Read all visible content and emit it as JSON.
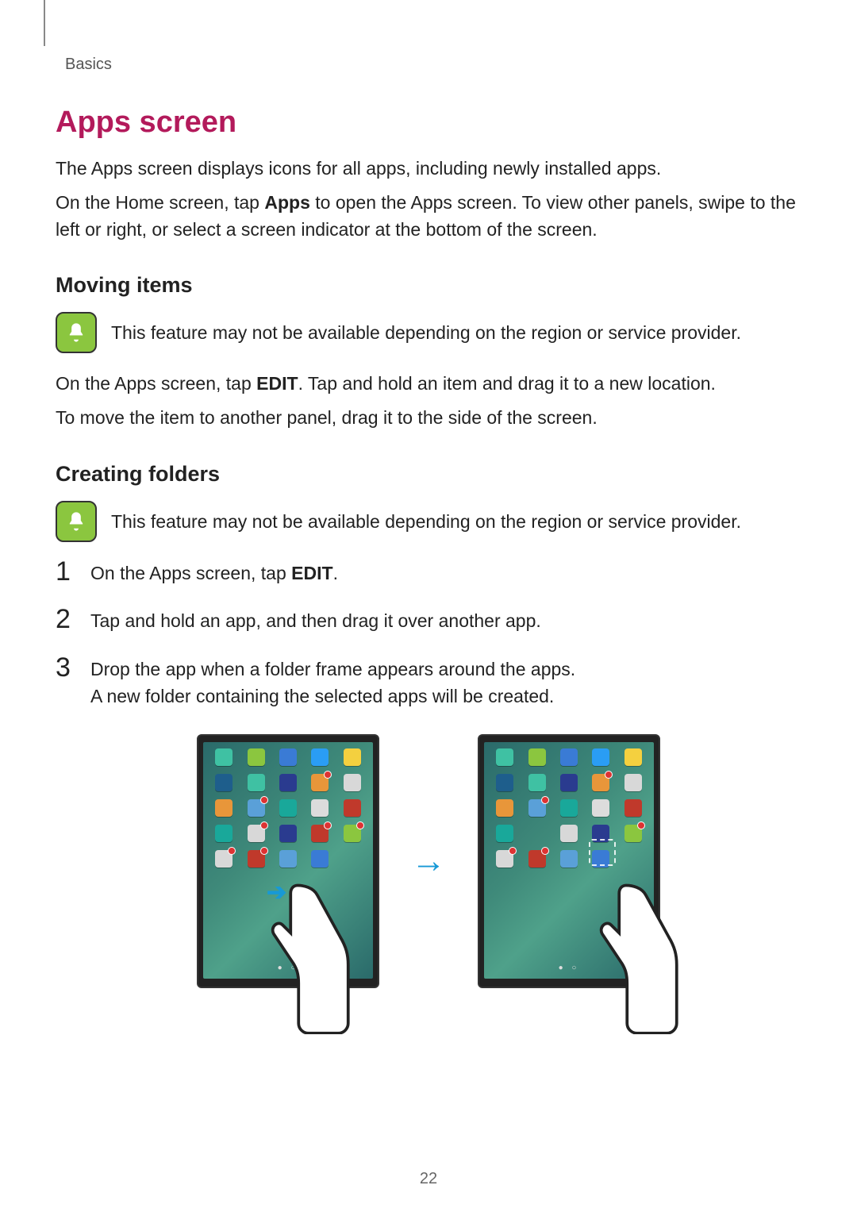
{
  "breadcrumb": "Basics",
  "title": "Apps screen",
  "intro1": "The Apps screen displays icons for all apps, including newly installed apps.",
  "intro2_pre": "On the Home screen, tap ",
  "intro2_bold": "Apps",
  "intro2_post": " to open the Apps screen. To view other panels, swipe to the left or right, or select a screen indicator at the bottom of the screen.",
  "moving": {
    "heading": "Moving items",
    "note": "This feature may not be available depending on the region or service provider.",
    "p1_pre": "On the Apps screen, tap ",
    "p1_bold": "EDIT",
    "p1_post": ". Tap and hold an item and drag it to a new location.",
    "p2": "To move the item to another panel, drag it to the side of the screen."
  },
  "creating": {
    "heading": "Creating folders",
    "note": "This feature may not be available depending on the region or service provider.",
    "steps": {
      "s1_pre": "On the Apps screen, tap ",
      "s1_bold": "EDIT",
      "s1_post": ".",
      "s2": "Tap and hold an app, and then drag it over another app.",
      "s3a": "Drop the app when a folder frame appears around the apps.",
      "s3b": "A new folder containing the selected apps will be created."
    }
  },
  "page_number": "22",
  "icon_colors": {
    "r1": [
      "#3fc1a3",
      "#8bc63f",
      "#3a7bd5",
      "#2a9df4",
      "#f4d03f"
    ],
    "r2": [
      "#1e5e8c",
      "#3fc1a3",
      "#2a3b8f",
      "#e8963a",
      "#d8d8d8"
    ],
    "r3": [
      "#e8963a",
      "#5aa0d8",
      "#19a89a",
      "#dcdcdc",
      "#c0392b"
    ],
    "r4": [
      "#19a89a",
      "#d8d8d8",
      "#2a3b8f",
      "#c0392b",
      "#8bc63f"
    ],
    "r5": [
      "#d8d8d8",
      "#c0392b",
      "#5aa0d8",
      "#3a7bd5",
      ""
    ]
  }
}
